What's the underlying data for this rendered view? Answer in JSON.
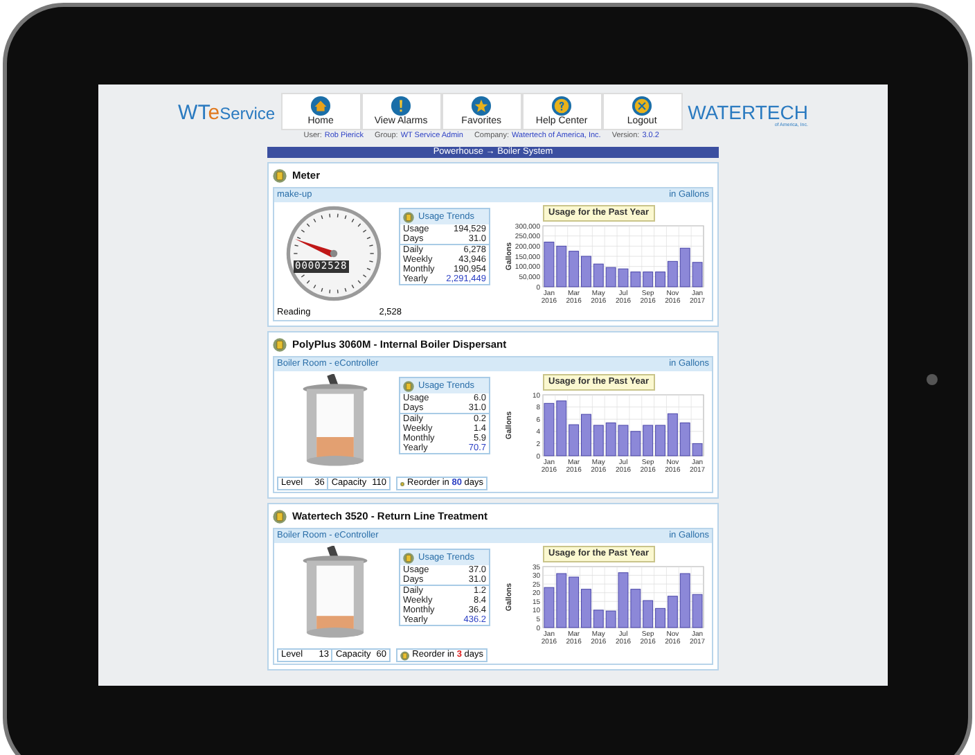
{
  "header": {
    "logo_left": {
      "a": "WT",
      "b": "e",
      "c": "Service"
    },
    "logo_right": "WATERTECH",
    "logo_right_sub": "of America, Inc.",
    "nav": [
      {
        "label": "Home"
      },
      {
        "label": "View Alarms"
      },
      {
        "label": "Favorites"
      },
      {
        "label": "Help Center"
      },
      {
        "label": "Logout"
      }
    ],
    "info": [
      {
        "label": "User:",
        "value": "Rob Pierick"
      },
      {
        "label": "Group:",
        "value": "WT Service Admin"
      },
      {
        "label": "Company:",
        "value": "Watertech of America, Inc."
      },
      {
        "label": "Version:",
        "value": "3.0.2"
      }
    ]
  },
  "breadcrumb": "Powerhouse → Boiler System",
  "cards": [
    {
      "kind": "meter",
      "title": "Meter",
      "location": "make-up",
      "unit": "in Gallons",
      "odometer": "00002528",
      "reading_label": "Reading",
      "reading": "2,528",
      "trends": {
        "title": "Usage Trends",
        "top": [
          {
            "label": "Usage",
            "value": "194,529"
          },
          {
            "label": "Days",
            "value": "31.0"
          }
        ],
        "bottom": [
          {
            "label": "Daily",
            "value": "6,278"
          },
          {
            "label": "Weekly",
            "value": "43,946"
          },
          {
            "label": "Monthly",
            "value": "190,954"
          },
          {
            "label": "Yearly",
            "value": "2,291,449"
          }
        ]
      },
      "chart_data": {
        "type": "bar",
        "title": "Usage for the Past Year",
        "ylabel": "Gallons",
        "categories": [
          "Jan 2016",
          null,
          "Mar 2016",
          null,
          "May 2016",
          null,
          "Jul 2016",
          null,
          "Sep 2016",
          null,
          "Nov 2016",
          null,
          "Jan 2017"
        ],
        "ylim": [
          0,
          300000
        ],
        "grid": true,
        "yticks": [
          {
            "value": 0,
            "label": "0"
          },
          {
            "value": 50000,
            "label": "50,000"
          },
          {
            "value": 100000,
            "label": "100,000"
          },
          {
            "value": 150000,
            "label": "150,000"
          },
          {
            "value": 200000,
            "label": "200,000"
          },
          {
            "value": 250000,
            "label": "250,000"
          },
          {
            "value": 300000,
            "label": "300,000"
          }
        ],
        "values": [
          220000,
          200000,
          175000,
          150000,
          112000,
          95000,
          88000,
          73000,
          73000,
          73000,
          125000,
          190000,
          120000
        ]
      }
    },
    {
      "kind": "tank",
      "title": "PolyPlus 3060M - Internal Boiler Dispersant",
      "location": "Boiler Room - eController",
      "unit": "in Gallons",
      "level": 0.33,
      "level_label": "Level",
      "level_value": "36",
      "capacity_label": "Capacity",
      "capacity": "110",
      "reorder": {
        "prefix": "Reorder in",
        "days": "80",
        "suffix": "days",
        "color": "#2b3fc4"
      },
      "trends": {
        "title": "Usage Trends",
        "top": [
          {
            "label": "Usage",
            "value": "6.0"
          },
          {
            "label": "Days",
            "value": "31.0"
          }
        ],
        "bottom": [
          {
            "label": "Daily",
            "value": "0.2"
          },
          {
            "label": "Weekly",
            "value": "1.4"
          },
          {
            "label": "Monthly",
            "value": "5.9"
          },
          {
            "label": "Yearly",
            "value": "70.7"
          }
        ]
      },
      "chart_data": {
        "type": "bar",
        "title": "Usage for the Past Year",
        "ylabel": "Gallons",
        "categories": [
          "Jan 2016",
          null,
          "Mar 2016",
          null,
          "May 2016",
          null,
          "Jul 2016",
          null,
          "Sep 2016",
          null,
          "Nov 2016",
          null,
          "Jan 2017"
        ],
        "ylim": [
          0,
          10
        ],
        "grid": true,
        "yticks": [
          0,
          2,
          4,
          6,
          8,
          10
        ],
        "values": [
          8.6,
          9,
          5.1,
          6.8,
          5,
          5.4,
          5,
          4,
          5,
          5,
          6.9,
          5.4,
          2
        ]
      }
    },
    {
      "kind": "tank",
      "title": "Watertech 3520 - Return Line Treatment",
      "location": "Boiler Room - eController",
      "unit": "in Gallons",
      "level": 0.22,
      "level_label": "Level",
      "level_value": "13",
      "capacity_label": "Capacity",
      "capacity": "60",
      "reorder": {
        "prefix": "Reorder in",
        "days": "3",
        "suffix": "days",
        "color": "#e02020"
      },
      "trends": {
        "title": "Usage Trends",
        "top": [
          {
            "label": "Usage",
            "value": "37.0"
          },
          {
            "label": "Days",
            "value": "31.0"
          }
        ],
        "bottom": [
          {
            "label": "Daily",
            "value": "1.2"
          },
          {
            "label": "Weekly",
            "value": "8.4"
          },
          {
            "label": "Monthly",
            "value": "36.4"
          },
          {
            "label": "Yearly",
            "value": "436.2"
          }
        ]
      },
      "chart_data": {
        "type": "bar",
        "title": "Usage for the Past Year",
        "ylabel": "Gallons",
        "categories": [
          "Jan 2016",
          null,
          "Mar 2016",
          null,
          "May 2016",
          null,
          "Jul 2016",
          null,
          "Sep 2016",
          null,
          "Nov 2016",
          null,
          "Jan 2017"
        ],
        "ylim": [
          0,
          35
        ],
        "grid": true,
        "yticks": [
          0,
          5,
          10,
          15,
          20,
          25,
          30,
          35
        ],
        "values": [
          23,
          31,
          29,
          22,
          10,
          9.5,
          31.5,
          22,
          15.5,
          11,
          18,
          31,
          19
        ]
      }
    }
  ]
}
